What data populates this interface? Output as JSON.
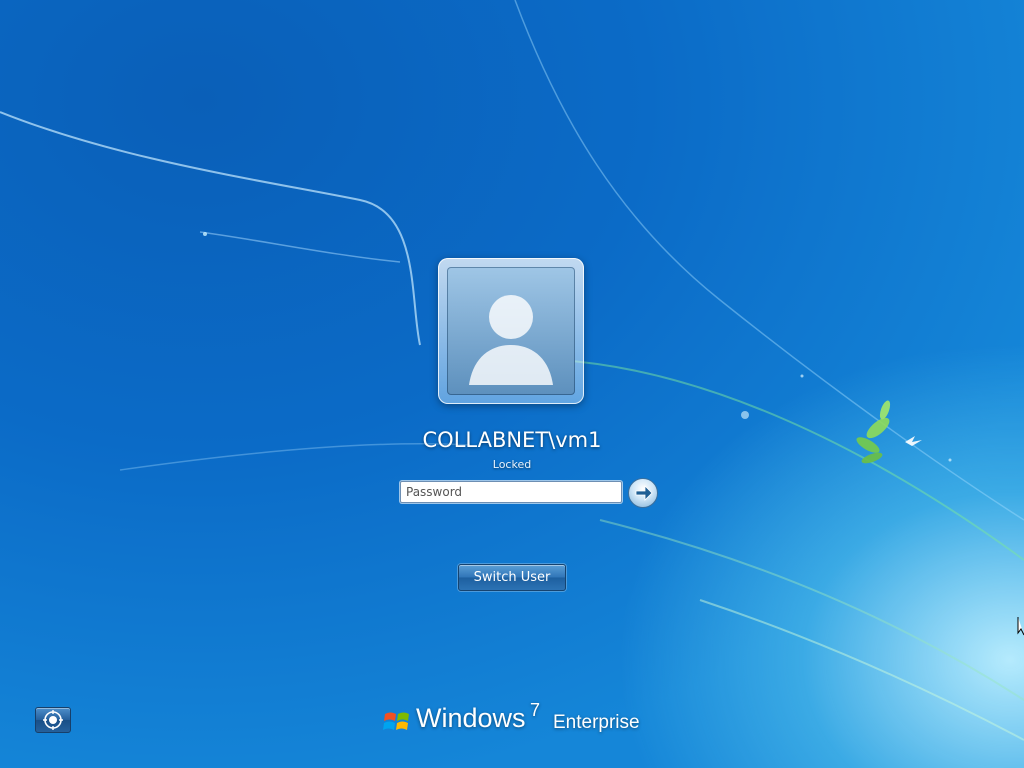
{
  "user": {
    "name": "COLLABNET\\vm1",
    "status": "Locked",
    "picture_icon": "user-placeholder-icon"
  },
  "login": {
    "password_placeholder": "Password",
    "submit_icon": "arrow-right-icon"
  },
  "actions": {
    "switch_user_label": "Switch User"
  },
  "ease_of_access": {
    "icon": "ease-of-access-icon"
  },
  "branding": {
    "windows": "Windows",
    "version": "7",
    "edition": "Enterprise",
    "logo_icon": "windows-flag-icon"
  },
  "colors": {
    "background": "#0b6bc7",
    "button_blue": "#2f74b7",
    "text": "#ffffff"
  }
}
